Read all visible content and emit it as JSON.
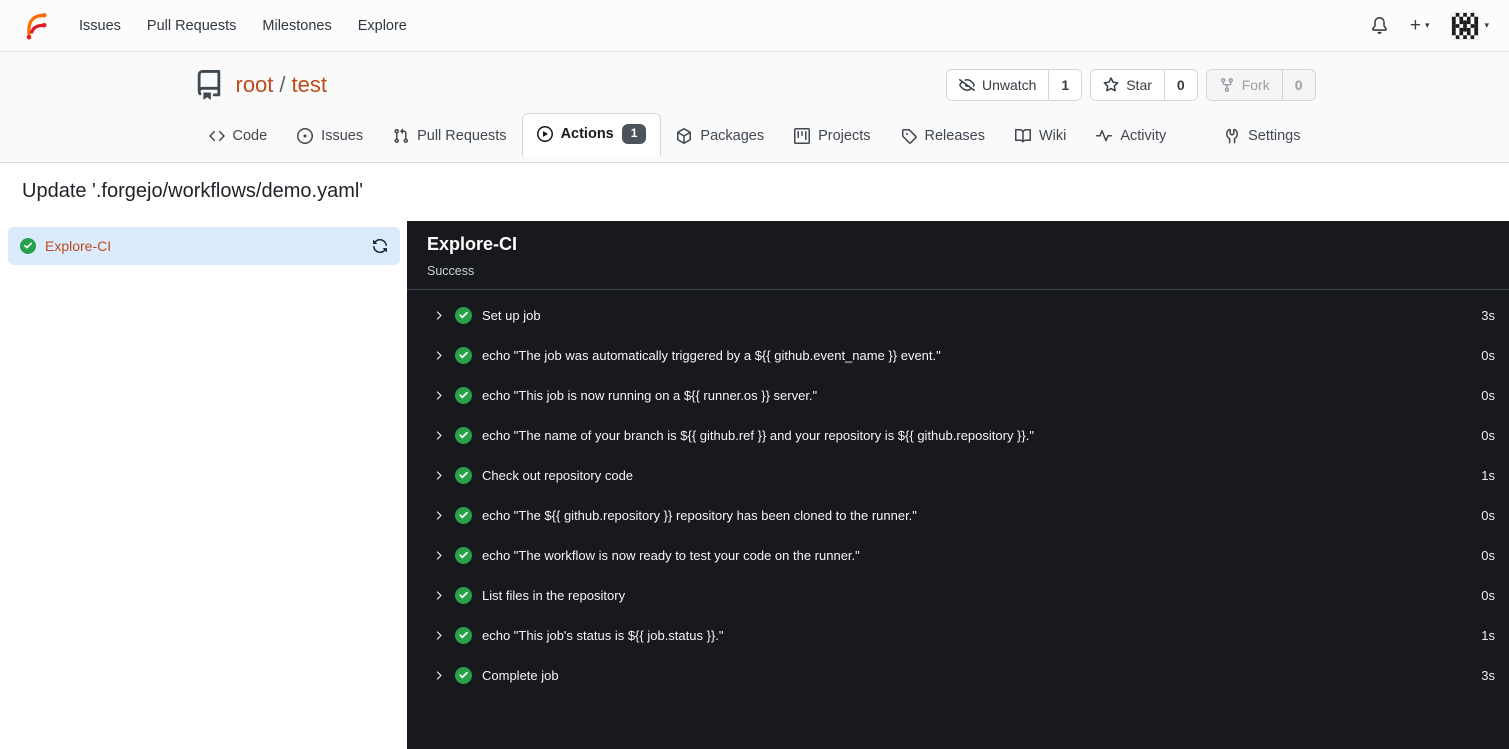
{
  "topnav": {
    "links": [
      "Issues",
      "Pull Requests",
      "Milestones",
      "Explore"
    ],
    "new_label": "+"
  },
  "repo": {
    "owner": "root",
    "slash": "/",
    "name": "test",
    "buttons": {
      "unwatch": {
        "label": "Unwatch",
        "count": "1"
      },
      "star": {
        "label": "Star",
        "count": "0"
      },
      "fork": {
        "label": "Fork",
        "count": "0"
      }
    },
    "tabs": [
      {
        "label": "Code"
      },
      {
        "label": "Issues"
      },
      {
        "label": "Pull Requests"
      },
      {
        "label": "Actions",
        "badge": "1"
      },
      {
        "label": "Packages"
      },
      {
        "label": "Projects"
      },
      {
        "label": "Releases"
      },
      {
        "label": "Wiki"
      },
      {
        "label": "Activity"
      },
      {
        "label": "Settings"
      }
    ]
  },
  "run": {
    "title": "Update '.forgejo/workflows/demo.yaml'",
    "job": {
      "name": "Explore-CI",
      "status": "success"
    },
    "panel": {
      "title": "Explore-CI",
      "status": "Success"
    },
    "steps": [
      {
        "label": "Set up job",
        "duration": "3s"
      },
      {
        "label": "echo \"The job was automatically triggered by a ${{ github.event_name }} event.\"",
        "duration": "0s"
      },
      {
        "label": "echo \"This job is now running on a ${{ runner.os }} server.\"",
        "duration": "0s"
      },
      {
        "label": "echo \"The name of your branch is ${{ github.ref }} and your repository is ${{ github.repository }}.\"",
        "duration": "0s"
      },
      {
        "label": "Check out repository code",
        "duration": "1s"
      },
      {
        "label": "echo \"The ${{ github.repository }} repository has been cloned to the runner.\"",
        "duration": "0s"
      },
      {
        "label": "echo \"The workflow is now ready to test your code on the runner.\"",
        "duration": "0s"
      },
      {
        "label": "List files in the repository",
        "duration": "0s"
      },
      {
        "label": "echo \"This job's status is ${{ job.status }}.\"",
        "duration": "1s"
      },
      {
        "label": "Complete job",
        "duration": "3s"
      }
    ]
  },
  "colors": {
    "primary_link": "#bc4c1c",
    "success_green": "#28a04c",
    "panel_bg": "#17191c",
    "selected_job_bg": "#dbeafc",
    "badge_bg": "#4c535b"
  }
}
